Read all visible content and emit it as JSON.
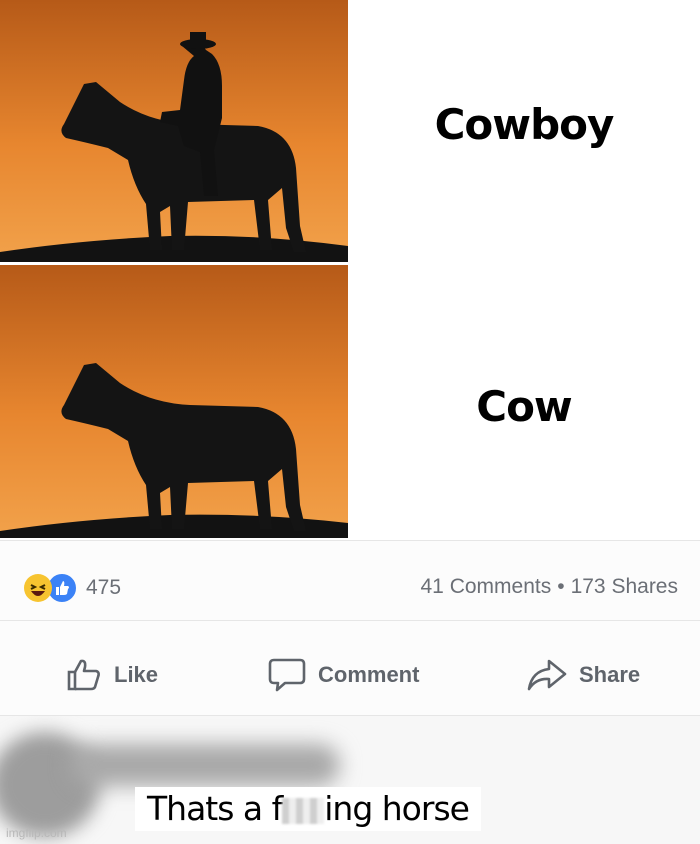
{
  "panels": [
    {
      "caption": "Cowboy",
      "image": "cowboy-on-horse-silhouette-sunset"
    },
    {
      "caption": "Cow",
      "image": "horse-silhouette-sunset"
    }
  ],
  "post": {
    "reactions": {
      "icons": [
        "haha-emoji",
        "like-thumb"
      ],
      "count": "475"
    },
    "comments_label": "41 Comments",
    "separator": "•",
    "shares_label": "173 Shares",
    "actions": {
      "like": "Like",
      "comment": "Comment",
      "share": "Share"
    }
  },
  "comment": {
    "prefix": "Thats a f",
    "suffix": "ing horse"
  },
  "watermark": "imgflip.com",
  "colors": {
    "sunset_top": "#b65a18",
    "sunset_mid": "#e7862f",
    "fb_gray_text": "#6b6f76",
    "like_blue": "#3b82f6"
  }
}
